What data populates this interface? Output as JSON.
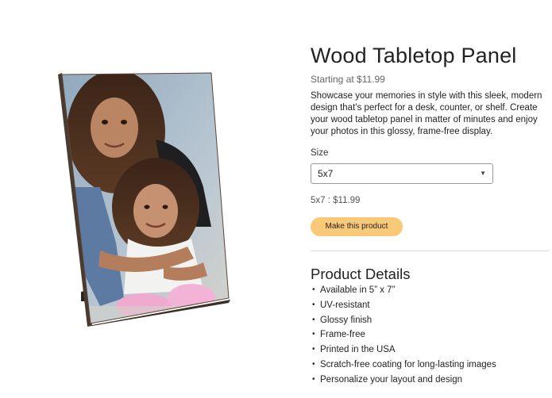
{
  "product": {
    "title": "Wood Tabletop Panel",
    "starting_price": "Starting at $11.99",
    "description": "Showcase your memories in style with this sleek, modern design that’s perfect for a desk, counter, or shelf. Create your wood tabletop panel in matter of minutes and enjoy your photos in this glossy, frame-free display."
  },
  "size": {
    "label": "Size",
    "selected": "5x7",
    "caret_icon": "chevron-down-icon"
  },
  "selected_price": "5x7 : $11.99",
  "make_button_label": "Make this product",
  "details": {
    "heading": "Product Details",
    "features": [
      "Available in 5” x 7”",
      "UV-resistant",
      "Glossy finish",
      "Frame-free",
      "Printed in the USA",
      "Scratch-free coating for long-lasting images",
      "Personalize your layout and design"
    ]
  },
  "colors": {
    "button_bg": "#f9c97a",
    "panel_edge": "#4a3a30",
    "divider": "#d8d8d8"
  }
}
